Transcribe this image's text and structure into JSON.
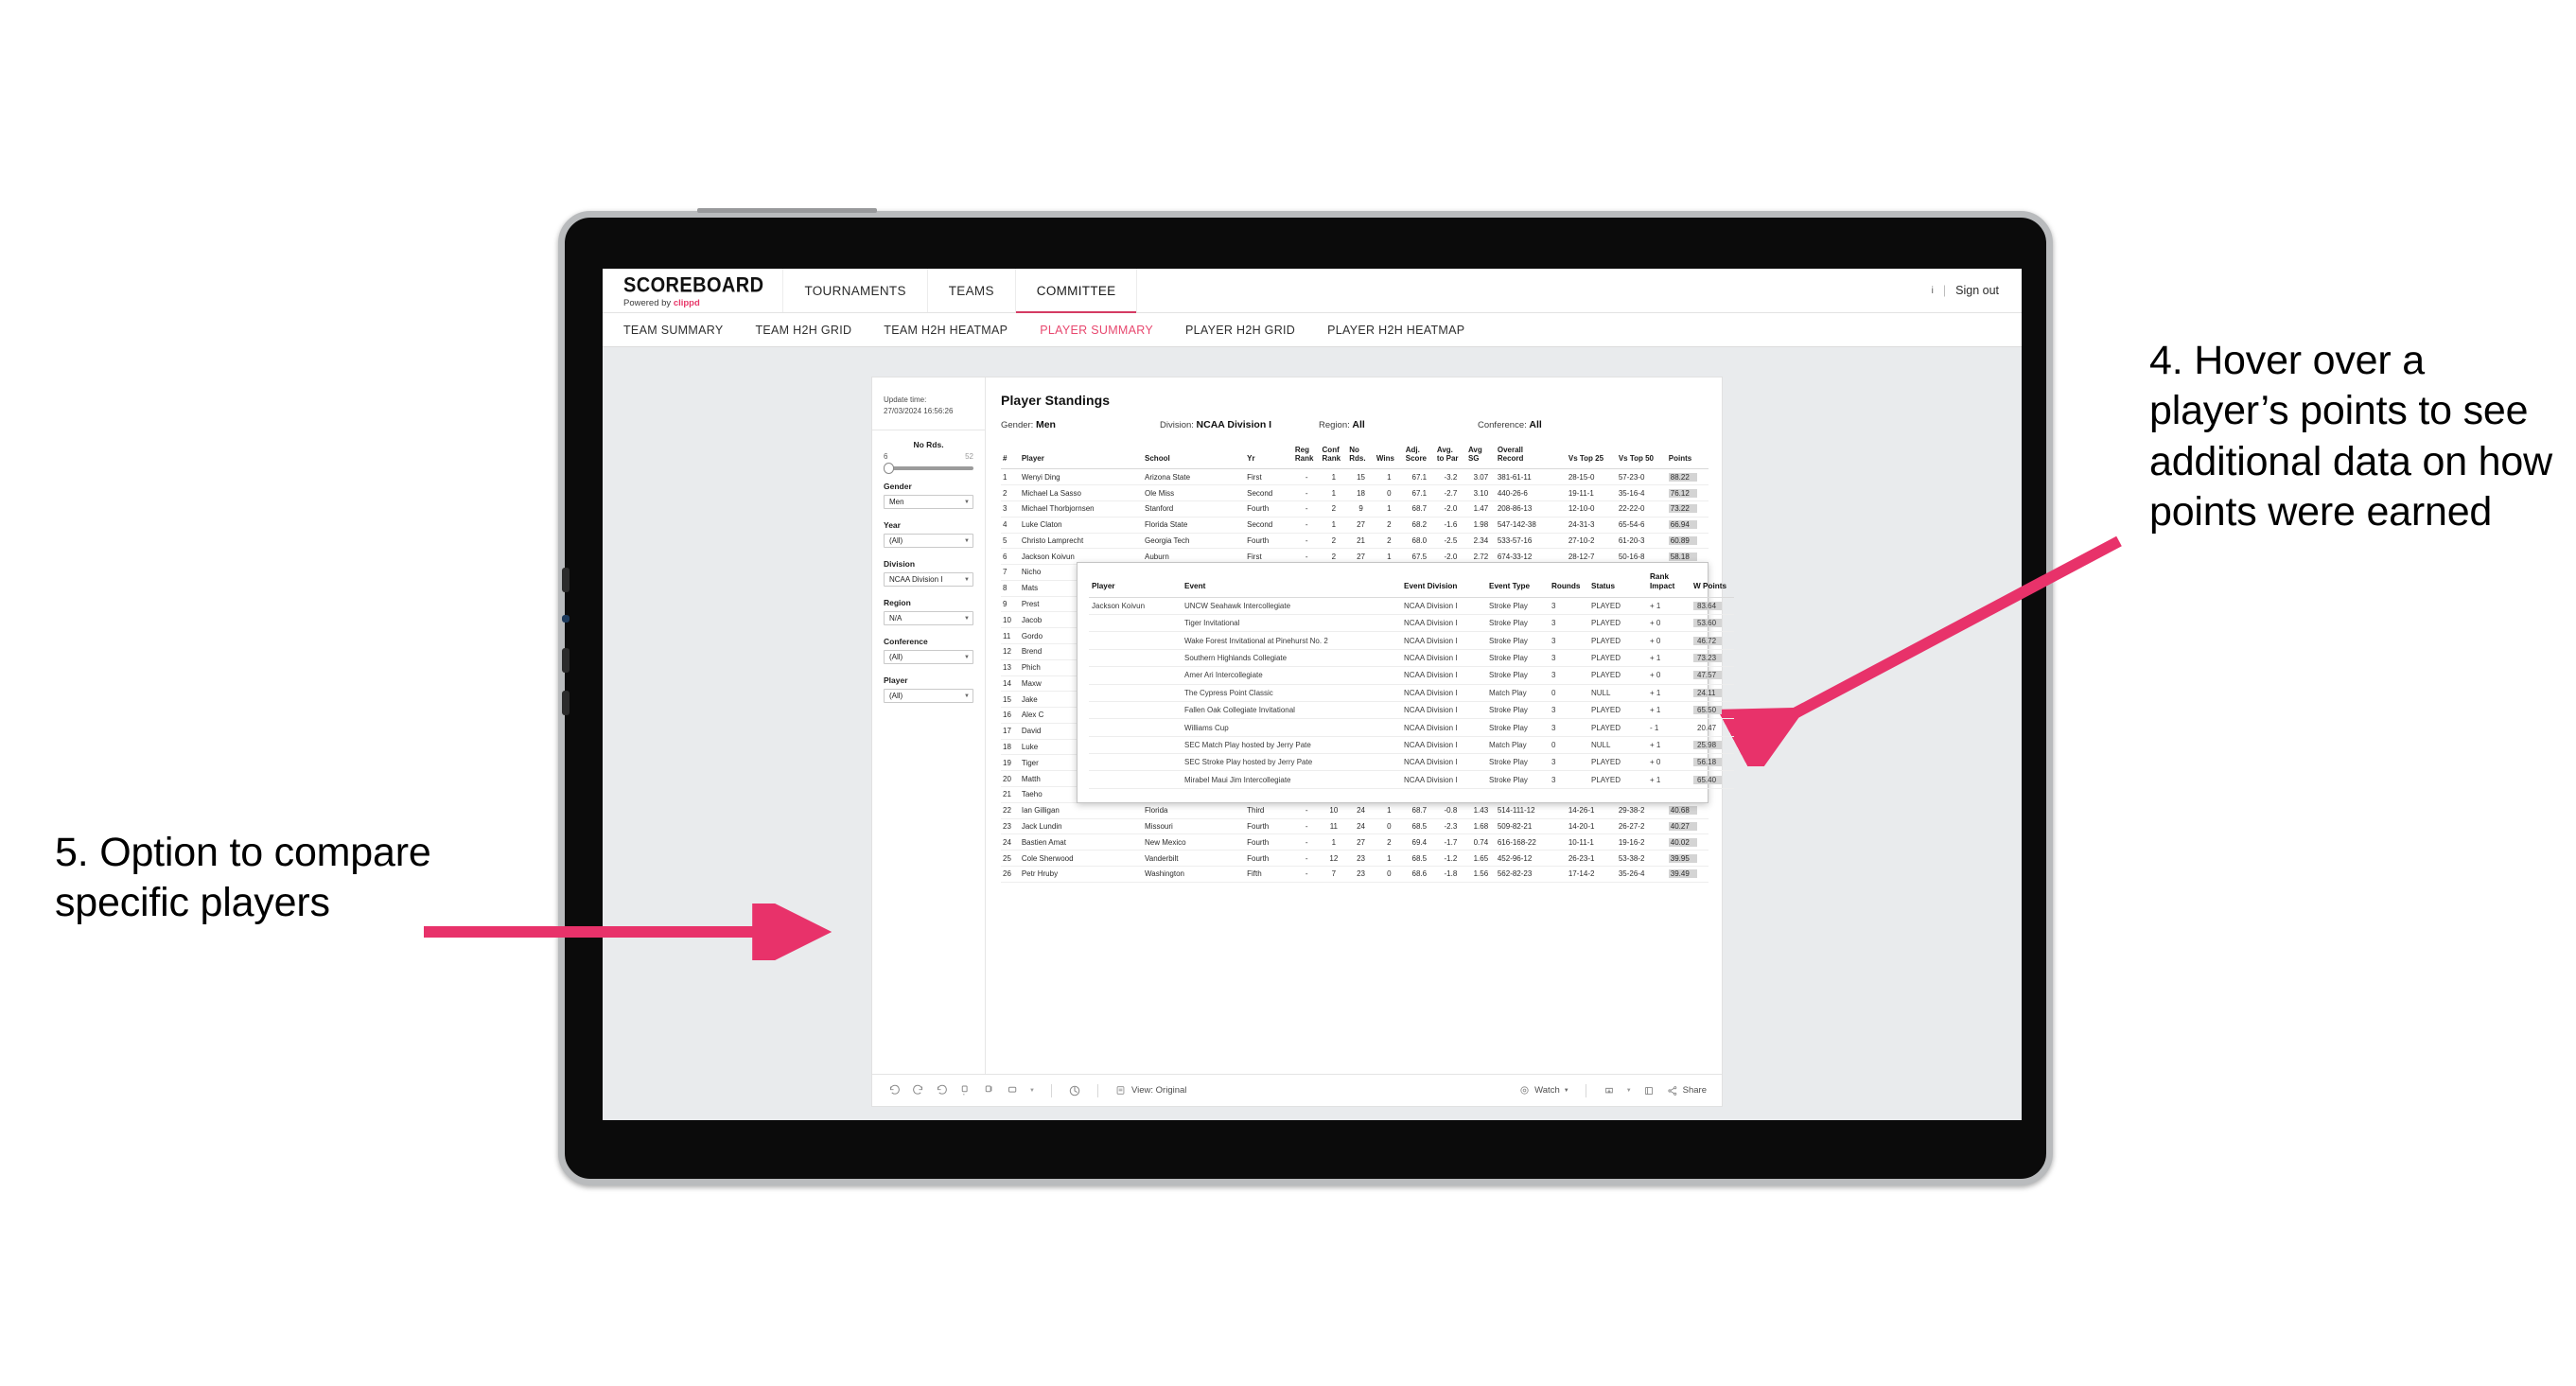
{
  "header": {
    "brand_logo": "SCOREBOARD",
    "brand_sub_prefix": "Powered by ",
    "brand_sub_brand": "clippd",
    "nav": [
      {
        "label": "TOURNAMENTS",
        "active": false
      },
      {
        "label": "TEAMS",
        "active": false
      },
      {
        "label": "COMMITTEE",
        "active": true
      }
    ],
    "user_initial": "i",
    "divider": "|",
    "sign_out": "Sign out"
  },
  "subtabs": [
    {
      "label": "TEAM SUMMARY",
      "active": false
    },
    {
      "label": "TEAM H2H GRID",
      "active": false
    },
    {
      "label": "TEAM H2H HEATMAP",
      "active": false
    },
    {
      "label": "PLAYER SUMMARY",
      "active": true
    },
    {
      "label": "PLAYER H2H GRID",
      "active": false
    },
    {
      "label": "PLAYER H2H HEATMAP",
      "active": false
    }
  ],
  "sidebar": {
    "update_time_label": "Update time:",
    "update_time_value": "27/03/2024 16:56:26",
    "slider": {
      "title": "No Rds.",
      "min": "6",
      "max": "52"
    },
    "filters": [
      {
        "label": "Gender",
        "value": "Men"
      },
      {
        "label": "Year",
        "value": "(All)"
      },
      {
        "label": "Division",
        "value": "NCAA Division I"
      },
      {
        "label": "Region",
        "value": "N/A"
      },
      {
        "label": "Conference",
        "value": "(All)"
      },
      {
        "label": "Player",
        "value": "(All)"
      }
    ]
  },
  "viz": {
    "title": "Player Standings",
    "subfilters": [
      {
        "label": "Gender:",
        "value": "Men"
      },
      {
        "label": "Division:",
        "value": "NCAA Division I"
      },
      {
        "label": "Region:",
        "value": "All"
      },
      {
        "label": "Conference:",
        "value": "All"
      }
    ],
    "columns": [
      "#",
      "Player",
      "School",
      "Yr",
      "Reg Rank",
      "Conf Rank",
      "No Rds.",
      "Wins",
      "Adj. Score",
      "Avg. to Par",
      "Avg SG",
      "Overall Record",
      "Vs Top 25",
      "Vs Top 50",
      "Points"
    ],
    "columns_split": [
      {
        "l1": "#",
        "l2": ""
      },
      {
        "l1": "Player",
        "l2": ""
      },
      {
        "l1": "School",
        "l2": ""
      },
      {
        "l1": "Yr",
        "l2": ""
      },
      {
        "l1": "Reg",
        "l2": "Rank"
      },
      {
        "l1": "Conf",
        "l2": "Rank"
      },
      {
        "l1": "No",
        "l2": "Rds."
      },
      {
        "l1": "Wins",
        "l2": ""
      },
      {
        "l1": "Adj.",
        "l2": "Score"
      },
      {
        "l1": "Avg.",
        "l2": "to Par"
      },
      {
        "l1": "Avg",
        "l2": "SG"
      },
      {
        "l1": "Overall",
        "l2": "Record"
      },
      {
        "l1": "Vs Top 25",
        "l2": ""
      },
      {
        "l1": "Vs Top 50",
        "l2": ""
      },
      {
        "l1": "Points",
        "l2": ""
      }
    ],
    "rows": [
      {
        "n": "1",
        "player": "Wenyi Ding",
        "school": "Arizona State",
        "yr": "First",
        "reg": "-",
        "conf": "1",
        "rds": "15",
        "wins": "1",
        "adj": "67.1",
        "par": "-3.2",
        "sg": "3.07",
        "ovr": "381-61-11",
        "t25": "28-15-0",
        "t50": "57-23-0",
        "pts": "88.22",
        "hl": true,
        "hidden": false
      },
      {
        "n": "2",
        "player": "Michael La Sasso",
        "school": "Ole Miss",
        "yr": "Second",
        "reg": "-",
        "conf": "1",
        "rds": "18",
        "wins": "0",
        "adj": "67.1",
        "par": "-2.7",
        "sg": "3.10",
        "ovr": "440-26-6",
        "t25": "19-11-1",
        "t50": "35-16-4",
        "pts": "76.12",
        "hl": true,
        "hidden": false
      },
      {
        "n": "3",
        "player": "Michael Thorbjornsen",
        "school": "Stanford",
        "yr": "Fourth",
        "reg": "-",
        "conf": "2",
        "rds": "9",
        "wins": "1",
        "adj": "68.7",
        "par": "-2.0",
        "sg": "1.47",
        "ovr": "208-86-13",
        "t25": "12-10-0",
        "t50": "22-22-0",
        "pts": "73.22",
        "hl": true,
        "hidden": false
      },
      {
        "n": "4",
        "player": "Luke Claton",
        "school": "Florida State",
        "yr": "Second",
        "reg": "-",
        "conf": "1",
        "rds": "27",
        "wins": "2",
        "adj": "68.2",
        "par": "-1.6",
        "sg": "1.98",
        "ovr": "547-142-38",
        "t25": "24-31-3",
        "t50": "65-54-6",
        "pts": "66.94",
        "hl": true,
        "hidden": false
      },
      {
        "n": "5",
        "player": "Christo Lamprecht",
        "school": "Georgia Tech",
        "yr": "Fourth",
        "reg": "-",
        "conf": "2",
        "rds": "21",
        "wins": "2",
        "adj": "68.0",
        "par": "-2.5",
        "sg": "2.34",
        "ovr": "533-57-16",
        "t25": "27-10-2",
        "t50": "61-20-3",
        "pts": "60.89",
        "hl": true,
        "hidden": false
      },
      {
        "n": "6",
        "player": "Jackson Koivun",
        "school": "Auburn",
        "yr": "First",
        "reg": "-",
        "conf": "2",
        "rds": "27",
        "wins": "1",
        "adj": "67.5",
        "par": "-2.0",
        "sg": "2.72",
        "ovr": "674-33-12",
        "t25": "28-12-7",
        "t50": "50-16-8",
        "pts": "58.18",
        "hl": true,
        "hidden": false
      },
      {
        "n": "7",
        "player": "Nicho",
        "school": "",
        "yr": "",
        "reg": "",
        "conf": "",
        "rds": "",
        "wins": "",
        "adj": "",
        "par": "",
        "sg": "",
        "ovr": "",
        "t25": "",
        "t50": "",
        "pts": "",
        "hl": false,
        "hidden": true
      },
      {
        "n": "8",
        "player": "Mats",
        "school": "",
        "yr": "",
        "reg": "",
        "conf": "",
        "rds": "",
        "wins": "",
        "adj": "",
        "par": "",
        "sg": "",
        "ovr": "",
        "t25": "",
        "t50": "",
        "pts": "",
        "hl": false,
        "hidden": true
      },
      {
        "n": "9",
        "player": "Prest",
        "school": "",
        "yr": "",
        "reg": "",
        "conf": "",
        "rds": "",
        "wins": "",
        "adj": "",
        "par": "",
        "sg": "",
        "ovr": "",
        "t25": "",
        "t50": "",
        "pts": "",
        "hl": false,
        "hidden": true
      },
      {
        "n": "10",
        "player": "Jacob",
        "school": "",
        "yr": "",
        "reg": "",
        "conf": "",
        "rds": "",
        "wins": "",
        "adj": "",
        "par": "",
        "sg": "",
        "ovr": "",
        "t25": "",
        "t50": "",
        "pts": "",
        "hl": false,
        "hidden": true
      },
      {
        "n": "11",
        "player": "Gordo",
        "school": "",
        "yr": "",
        "reg": "",
        "conf": "",
        "rds": "",
        "wins": "",
        "adj": "",
        "par": "",
        "sg": "",
        "ovr": "",
        "t25": "",
        "t50": "",
        "pts": "",
        "hl": false,
        "hidden": true
      },
      {
        "n": "12",
        "player": "Brend",
        "school": "",
        "yr": "",
        "reg": "",
        "conf": "",
        "rds": "",
        "wins": "",
        "adj": "",
        "par": "",
        "sg": "",
        "ovr": "",
        "t25": "",
        "t50": "",
        "pts": "",
        "hl": false,
        "hidden": true
      },
      {
        "n": "13",
        "player": "Phich",
        "school": "",
        "yr": "",
        "reg": "",
        "conf": "",
        "rds": "",
        "wins": "",
        "adj": "",
        "par": "",
        "sg": "",
        "ovr": "",
        "t25": "",
        "t50": "",
        "pts": "",
        "hl": false,
        "hidden": true
      },
      {
        "n": "14",
        "player": "Maxw",
        "school": "",
        "yr": "",
        "reg": "",
        "conf": "",
        "rds": "",
        "wins": "",
        "adj": "",
        "par": "",
        "sg": "",
        "ovr": "",
        "t25": "",
        "t50": "",
        "pts": "",
        "hl": false,
        "hidden": true
      },
      {
        "n": "15",
        "player": "Jake",
        "school": "",
        "yr": "",
        "reg": "",
        "conf": "",
        "rds": "",
        "wins": "",
        "adj": "",
        "par": "",
        "sg": "",
        "ovr": "",
        "t25": "",
        "t50": "",
        "pts": "",
        "hl": false,
        "hidden": true
      },
      {
        "n": "16",
        "player": "Alex C",
        "school": "",
        "yr": "",
        "reg": "",
        "conf": "",
        "rds": "",
        "wins": "",
        "adj": "",
        "par": "",
        "sg": "",
        "ovr": "",
        "t25": "",
        "t50": "",
        "pts": "",
        "hl": false,
        "hidden": true
      },
      {
        "n": "17",
        "player": "David",
        "school": "",
        "yr": "",
        "reg": "",
        "conf": "",
        "rds": "",
        "wins": "",
        "adj": "",
        "par": "",
        "sg": "",
        "ovr": "",
        "t25": "",
        "t50": "",
        "pts": "",
        "hl": false,
        "hidden": true
      },
      {
        "n": "18",
        "player": "Luke",
        "school": "",
        "yr": "",
        "reg": "",
        "conf": "",
        "rds": "",
        "wins": "",
        "adj": "",
        "par": "",
        "sg": "",
        "ovr": "",
        "t25": "",
        "t50": "",
        "pts": "",
        "hl": false,
        "hidden": true
      },
      {
        "n": "19",
        "player": "Tiger",
        "school": "",
        "yr": "",
        "reg": "",
        "conf": "",
        "rds": "",
        "wins": "",
        "adj": "",
        "par": "",
        "sg": "",
        "ovr": "",
        "t25": "",
        "t50": "",
        "pts": "",
        "hl": false,
        "hidden": true
      },
      {
        "n": "20",
        "player": "Matth",
        "school": "",
        "yr": "",
        "reg": "",
        "conf": "",
        "rds": "",
        "wins": "",
        "adj": "",
        "par": "",
        "sg": "",
        "ovr": "",
        "t25": "",
        "t50": "",
        "pts": "",
        "hl": false,
        "hidden": true
      },
      {
        "n": "21",
        "player": "Taeho",
        "school": "",
        "yr": "",
        "reg": "",
        "conf": "",
        "rds": "",
        "wins": "",
        "adj": "",
        "par": "",
        "sg": "",
        "ovr": "",
        "t25": "",
        "t50": "",
        "pts": "",
        "hl": false,
        "hidden": true
      },
      {
        "n": "22",
        "player": "Ian Gilligan",
        "school": "Florida",
        "yr": "Third",
        "reg": "-",
        "conf": "10",
        "rds": "24",
        "wins": "1",
        "adj": "68.7",
        "par": "-0.8",
        "sg": "1.43",
        "ovr": "514-111-12",
        "t25": "14-26-1",
        "t50": "29-38-2",
        "pts": "40.68",
        "hl": true,
        "hidden": false
      },
      {
        "n": "23",
        "player": "Jack Lundin",
        "school": "Missouri",
        "yr": "Fourth",
        "reg": "-",
        "conf": "11",
        "rds": "24",
        "wins": "0",
        "adj": "68.5",
        "par": "-2.3",
        "sg": "1.68",
        "ovr": "509-82-21",
        "t25": "14-20-1",
        "t50": "26-27-2",
        "pts": "40.27",
        "hl": true,
        "hidden": false
      },
      {
        "n": "24",
        "player": "Bastien Amat",
        "school": "New Mexico",
        "yr": "Fourth",
        "reg": "-",
        "conf": "1",
        "rds": "27",
        "wins": "2",
        "adj": "69.4",
        "par": "-1.7",
        "sg": "0.74",
        "ovr": "616-168-22",
        "t25": "10-11-1",
        "t50": "19-16-2",
        "pts": "40.02",
        "hl": true,
        "hidden": false
      },
      {
        "n": "25",
        "player": "Cole Sherwood",
        "school": "Vanderbilt",
        "yr": "Fourth",
        "reg": "-",
        "conf": "12",
        "rds": "23",
        "wins": "1",
        "adj": "68.5",
        "par": "-1.2",
        "sg": "1.65",
        "ovr": "452-96-12",
        "t25": "26-23-1",
        "t50": "53-38-2",
        "pts": "39.95",
        "hl": true,
        "hidden": false
      },
      {
        "n": "26",
        "player": "Petr Hruby",
        "school": "Washington",
        "yr": "Fifth",
        "reg": "-",
        "conf": "7",
        "rds": "23",
        "wins": "0",
        "adj": "68.6",
        "par": "-1.8",
        "sg": "1.56",
        "ovr": "562-82-23",
        "t25": "17-14-2",
        "t50": "35-26-4",
        "pts": "39.49",
        "hl": true,
        "hidden": false
      }
    ],
    "toolbar": {
      "view_label": "View: Original",
      "watch_label": "Watch",
      "share_label": "Share",
      "icons": [
        "undo-icon",
        "redo-icon",
        "revert-icon",
        "refresh-icon",
        "pause-icon",
        "custom-view-icon",
        "chevron-down-icon",
        "reset-icon",
        "view-icon",
        "watch-icon",
        "download-icon",
        "fullscreen-icon",
        "share-icon"
      ]
    }
  },
  "tooltip": {
    "columns": [
      {
        "l1": "Player",
        "l2": ""
      },
      {
        "l1": "Event",
        "l2": ""
      },
      {
        "l1": "Event Division",
        "l2": ""
      },
      {
        "l1": "Event Type",
        "l2": ""
      },
      {
        "l1": "Rounds",
        "l2": ""
      },
      {
        "l1": "Status",
        "l2": ""
      },
      {
        "l1": "Rank",
        "l2": "Impact"
      },
      {
        "l1": "W Points",
        "l2": ""
      }
    ],
    "player": "Jackson Koivun",
    "rows": [
      {
        "event": "UNCW Seahawk Intercollegiate",
        "division": "NCAA Division I",
        "type": "Stroke Play",
        "rounds": "3",
        "status": "PLAYED",
        "impact": "+ 1",
        "wpts": "83.64",
        "hl": true
      },
      {
        "event": "Tiger Invitational",
        "division": "NCAA Division I",
        "type": "Stroke Play",
        "rounds": "3",
        "status": "PLAYED",
        "impact": "+ 0",
        "wpts": "53.60",
        "hl": true
      },
      {
        "event": "Wake Forest Invitational at Pinehurst No. 2",
        "division": "NCAA Division I",
        "type": "Stroke Play",
        "rounds": "3",
        "status": "PLAYED",
        "impact": "+ 0",
        "wpts": "46.72",
        "hl": true
      },
      {
        "event": "Southern Highlands Collegiate",
        "division": "NCAA Division I",
        "type": "Stroke Play",
        "rounds": "3",
        "status": "PLAYED",
        "impact": "+ 1",
        "wpts": "73.23",
        "hl": true
      },
      {
        "event": "Amer Ari Intercollegiate",
        "division": "NCAA Division I",
        "type": "Stroke Play",
        "rounds": "3",
        "status": "PLAYED",
        "impact": "+ 0",
        "wpts": "47.57",
        "hl": true
      },
      {
        "event": "The Cypress Point Classic",
        "division": "NCAA Division I",
        "type": "Match Play",
        "rounds": "0",
        "status": "NULL",
        "impact": "+ 1",
        "wpts": "24.11",
        "hl": true
      },
      {
        "event": "Fallen Oak Collegiate Invitational",
        "division": "NCAA Division I",
        "type": "Stroke Play",
        "rounds": "3",
        "status": "PLAYED",
        "impact": "+ 1",
        "wpts": "65.50",
        "hl": true
      },
      {
        "event": "Williams Cup",
        "division": "NCAA Division I",
        "type": "Stroke Play",
        "rounds": "3",
        "status": "PLAYED",
        "impact": "- 1",
        "wpts": "20.47",
        "hl": false
      },
      {
        "event": "SEC Match Play hosted by Jerry Pate",
        "division": "NCAA Division I",
        "type": "Match Play",
        "rounds": "0",
        "status": "NULL",
        "impact": "+ 1",
        "wpts": "25.98",
        "hl": true
      },
      {
        "event": "SEC Stroke Play hosted by Jerry Pate",
        "division": "NCAA Division I",
        "type": "Stroke Play",
        "rounds": "3",
        "status": "PLAYED",
        "impact": "+ 0",
        "wpts": "56.18",
        "hl": true
      },
      {
        "event": "Mirabel Maui Jim Intercollegiate",
        "division": "NCAA Division I",
        "type": "Stroke Play",
        "rounds": "3",
        "status": "PLAYED",
        "impact": "+ 1",
        "wpts": "65.40",
        "hl": true
      }
    ]
  },
  "annotations": {
    "right": "4. Hover over a player’s points to see additional data on how points were earned",
    "left": "5. Option to compare specific players",
    "arrow_color": "#e8326a"
  }
}
